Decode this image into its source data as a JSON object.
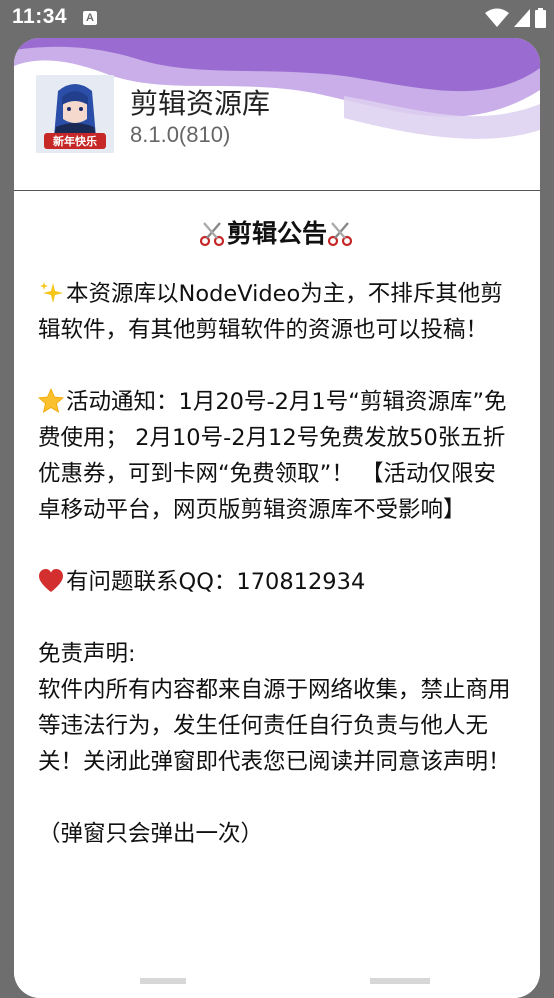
{
  "status_bar": {
    "time": "11:34",
    "notification_icon": "a-icon",
    "icons": [
      "wifi-icon",
      "signal-icon",
      "battery-icon"
    ]
  },
  "app": {
    "name": "剪辑资源库",
    "version": "8.1.0(810)",
    "icon_caption": "新年快乐"
  },
  "notice": {
    "title": "剪辑公告",
    "paragraphs": {
      "intro": "本资源库以NodeVideo为主，不排斥其他剪辑软件，有其他剪辑软件的资源也可以投稿！",
      "activity": "活动通知：1月20号-2月1号“剪辑资源库”免费使用； 2月10号-2月12号免费发放50张五折优惠券，可到卡网“免费领取”！ 【活动仅限安卓移动平台，网页版剪辑资源库不受影响】",
      "contact": "有问题联系QQ：170812934",
      "disclaimer_title": "免责声明:",
      "disclaimer_body": "软件内所有内容都来自源于网络收集，禁止商用等违法行为，发生任何责任自行负责与他人无关！关闭此弹窗即代表您已阅读并同意该声明！",
      "note": "（弹窗只会弹出一次）"
    }
  },
  "colors": {
    "wave_dark": "#9a6bd0",
    "wave_light": "#c9aee9",
    "status_bar_bg": "#6e6e6e"
  }
}
